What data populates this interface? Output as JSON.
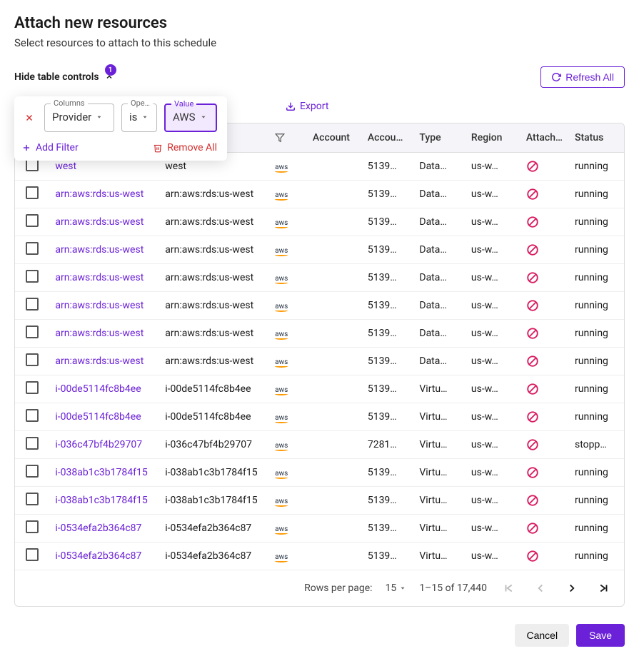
{
  "header": {
    "title": "Attach new resources",
    "subtitle": "Select resources to attach to this schedule"
  },
  "controls": {
    "hide_toggle": "Hide table controls",
    "badge_count": "1",
    "refresh_label": "Refresh All",
    "export_label": "Export"
  },
  "filter": {
    "columns_label": "Columns",
    "columns_value": "Provider",
    "operator_label": "Ope…",
    "operator_value": "is",
    "value_label": "Value",
    "value_value": "AWS",
    "add_filter": "Add Filter",
    "remove_all": "Remove All"
  },
  "columns": {
    "account": "Account",
    "account_id": "Accou…",
    "type": "Type",
    "region": "Region",
    "attached": "Attach…",
    "status": "Status"
  },
  "rows": [
    {
      "link": "west",
      "name": "west",
      "provider": "aws",
      "account": "",
      "account_id": "5139…",
      "type": "Data…",
      "region": "us-w…",
      "status": "running"
    },
    {
      "link": "arn:aws:rds:us-west",
      "name": "arn:aws:rds:us-west",
      "provider": "aws",
      "account": "",
      "account_id": "5139…",
      "type": "Data…",
      "region": "us-w…",
      "status": "running"
    },
    {
      "link": "arn:aws:rds:us-west",
      "name": "arn:aws:rds:us-west",
      "provider": "aws",
      "account": "",
      "account_id": "5139…",
      "type": "Data…",
      "region": "us-w…",
      "status": "running"
    },
    {
      "link": "arn:aws:rds:us-west",
      "name": "arn:aws:rds:us-west",
      "provider": "aws",
      "account": "",
      "account_id": "5139…",
      "type": "Data…",
      "region": "us-w…",
      "status": "running"
    },
    {
      "link": "arn:aws:rds:us-west",
      "name": "arn:aws:rds:us-west",
      "provider": "aws",
      "account": "",
      "account_id": "5139…",
      "type": "Data…",
      "region": "us-w…",
      "status": "running"
    },
    {
      "link": "arn:aws:rds:us-west",
      "name": "arn:aws:rds:us-west",
      "provider": "aws",
      "account": "",
      "account_id": "5139…",
      "type": "Data…",
      "region": "us-w…",
      "status": "running"
    },
    {
      "link": "arn:aws:rds:us-west",
      "name": "arn:aws:rds:us-west",
      "provider": "aws",
      "account": "",
      "account_id": "5139…",
      "type": "Data…",
      "region": "us-w…",
      "status": "running"
    },
    {
      "link": "arn:aws:rds:us-west",
      "name": "arn:aws:rds:us-west",
      "provider": "aws",
      "account": "",
      "account_id": "5139…",
      "type": "Data…",
      "region": "us-w…",
      "status": "running"
    },
    {
      "link": "i-00de5114fc8b4ee",
      "name": "i-00de5114fc8b4ee",
      "provider": "aws",
      "account": "",
      "account_id": "5139…",
      "type": "Virtu…",
      "region": "us-w…",
      "status": "running"
    },
    {
      "link": "i-00de5114fc8b4ee",
      "name": "i-00de5114fc8b4ee",
      "provider": "aws",
      "account": "",
      "account_id": "5139…",
      "type": "Virtu…",
      "region": "us-w…",
      "status": "running"
    },
    {
      "link": "i-036c47bf4b29707",
      "name": "i-036c47bf4b29707",
      "provider": "aws",
      "account": "",
      "account_id": "7281…",
      "type": "Virtu…",
      "region": "us-w…",
      "status": "stopp…"
    },
    {
      "link": "i-038ab1c3b1784f15",
      "name": "i-038ab1c3b1784f15",
      "provider": "aws",
      "account": "",
      "account_id": "5139…",
      "type": "Virtu…",
      "region": "us-w…",
      "status": "running"
    },
    {
      "link": "i-038ab1c3b1784f15",
      "name": "i-038ab1c3b1784f15",
      "provider": "aws",
      "account": "",
      "account_id": "5139…",
      "type": "Virtu…",
      "region": "us-w…",
      "status": "running"
    },
    {
      "link": "i-0534efa2b364c87",
      "name": "i-0534efa2b364c87",
      "provider": "aws",
      "account": "",
      "account_id": "5139…",
      "type": "Virtu…",
      "region": "us-w…",
      "status": "running"
    },
    {
      "link": "i-0534efa2b364c87",
      "name": "i-0534efa2b364c87",
      "provider": "aws",
      "account": "",
      "account_id": "5139…",
      "type": "Virtu…",
      "region": "us-w…",
      "status": "running"
    }
  ],
  "pagination": {
    "rows_label": "Rows per page:",
    "rows_value": "15",
    "summary": "1–15 of 17,440"
  },
  "footer": {
    "cancel": "Cancel",
    "save": "Save"
  }
}
